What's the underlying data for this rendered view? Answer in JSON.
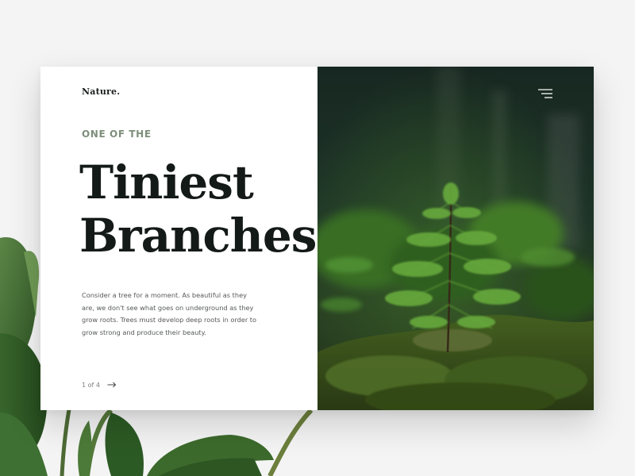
{
  "brand": {
    "name": "Nature."
  },
  "hero": {
    "eyebrow": "ONE OF THE",
    "title_line1": "Tiniest",
    "title_line2": "Branches",
    "description": "Consider a tree for a moment. As beautiful as they are, we don't see what goes on underground as they grow roots. Trees must develop deep roots in order to grow strong and produce their beauty."
  },
  "pager": {
    "label": "1 of 4"
  },
  "icons": {
    "menu": "hamburger-menu-icon",
    "next": "arrow-right-icon"
  },
  "colors": {
    "accent": "#7d8f7a",
    "heading": "#141a17",
    "background": "#f4f4f4"
  }
}
